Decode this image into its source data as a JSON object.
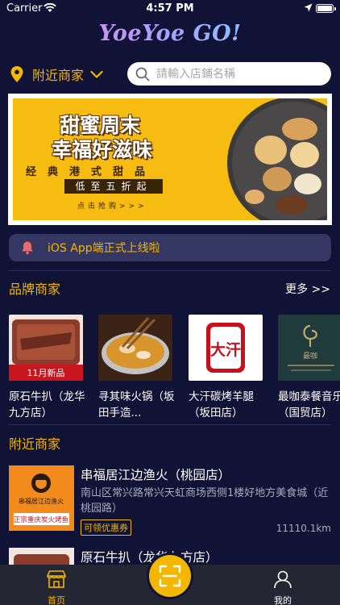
{
  "status_bar": {
    "carrier": "Carrier",
    "time": "4:57 PM"
  },
  "header": {
    "logo_text": "YoeYoe GO!"
  },
  "location": {
    "label": "附近商家"
  },
  "search": {
    "placeholder": "請輸入店鋪名稱"
  },
  "banner": {
    "title_line1": "甜蜜周末",
    "title_line2": "幸福好滋味",
    "subline": "经典港式甜品",
    "discount": "低至五折起",
    "cta": "点击抢购>>>"
  },
  "notice": {
    "text": "iOS App端正式上线啦"
  },
  "brands_section": {
    "title": "品牌商家",
    "more_label": "更多 >>",
    "items": [
      {
        "name": "原石牛扒（龙华九方店）",
        "thumb_caption": "11月新品"
      },
      {
        "name": "寻其味火锅（坂田手造...",
        "thumb_caption": ""
      },
      {
        "name": "大汗碳烤羊腿（坂田店）",
        "thumb_caption": "大汗"
      },
      {
        "name": "最咖泰餐音乐吧（国贸店）",
        "thumb_caption": "最咖"
      }
    ]
  },
  "nearby_section": {
    "title": "附近商家",
    "stores": [
      {
        "name": "串福居江边渔火（桃园店）",
        "address": "南山区常兴路常兴天虹商场西侧1楼好地方美食城（近桃园路）",
        "coupon": "可领优惠券",
        "distance": "11110.1km",
        "logo_caption": "串福居江边渔火",
        "logo_sub": "正宗重庆炭火烤鱼"
      },
      {
        "name": "原石牛扒（龙华九方店）",
        "address": "",
        "coupon": "",
        "distance": ""
      }
    ]
  },
  "tab_bar": {
    "home_label": "首页",
    "me_label": "我的"
  },
  "colors": {
    "background": "#101236",
    "accent": "#f4b700",
    "tab_bar": "#252633",
    "notice_bg": "#343761"
  }
}
